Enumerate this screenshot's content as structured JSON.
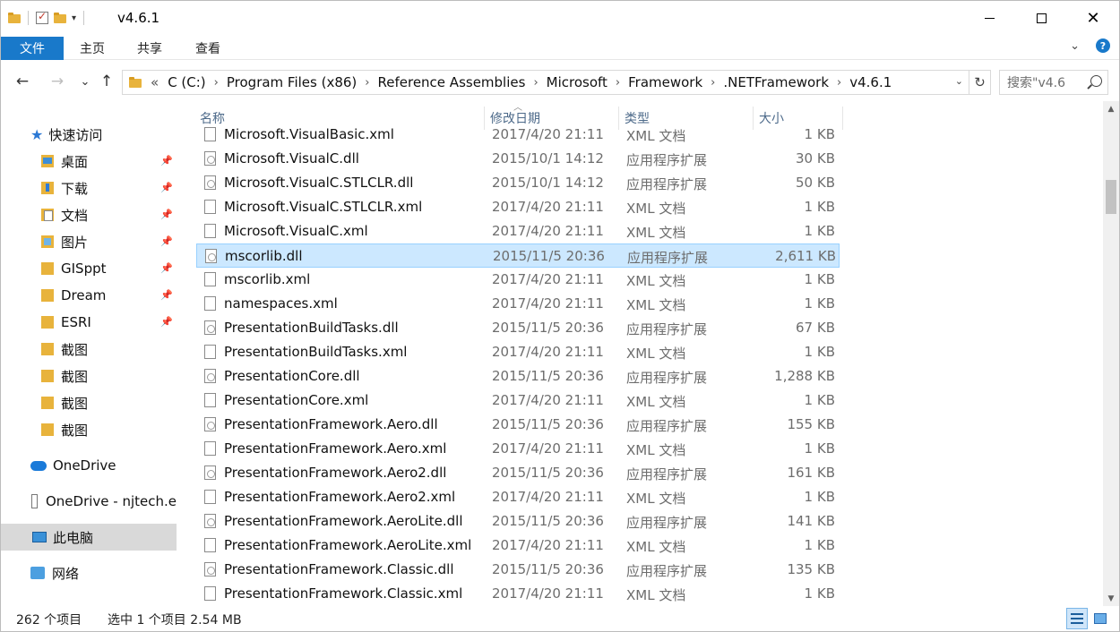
{
  "window": {
    "title": "v4.6.1",
    "controls": {
      "minimize": "minimize",
      "maximize": "maximize",
      "close": "✕"
    }
  },
  "ribbon": {
    "file_tab": "文件",
    "tabs": [
      "主页",
      "共享",
      "查看"
    ]
  },
  "navigation": {
    "back": "←",
    "forward": "→",
    "recent": "⌄",
    "up": "↑",
    "overflow": "«",
    "breadcrumbs": [
      "C (C:)",
      "Program Files (x86)",
      "Reference Assemblies",
      "Microsoft",
      "Framework",
      ".NETFramework",
      "v4.6.1"
    ],
    "separator": "›",
    "refresh": "↻",
    "search_placeholder": "搜索\"v4.6"
  },
  "sidebar": {
    "quick_access": "快速访问",
    "items": [
      {
        "label": "桌面",
        "icon": "desktop-folder-icon",
        "pinned": true
      },
      {
        "label": "下载",
        "icon": "download-folder-icon",
        "pinned": true
      },
      {
        "label": "文档",
        "icon": "documents-folder-icon",
        "pinned": true
      },
      {
        "label": "图片",
        "icon": "pictures-folder-icon",
        "pinned": true
      },
      {
        "label": "GISppt",
        "icon": "folder-icon",
        "pinned": true
      },
      {
        "label": "Dream",
        "icon": "folder-icon",
        "pinned": true
      },
      {
        "label": "ESRI",
        "icon": "folder-icon",
        "pinned": true
      },
      {
        "label": "截图",
        "icon": "folder-icon",
        "pinned": false
      },
      {
        "label": "截图",
        "icon": "folder-icon",
        "pinned": false
      },
      {
        "label": "截图",
        "icon": "folder-icon",
        "pinned": false
      },
      {
        "label": "截图",
        "icon": "folder-icon",
        "pinned": false
      }
    ],
    "onedrive": "OneDrive",
    "onedrive_org": "OneDrive - njtech.e",
    "this_pc": "此电脑",
    "network": "网络"
  },
  "columns": {
    "name": "名称",
    "date": "修改日期",
    "type": "类型",
    "size": "大小"
  },
  "files": [
    {
      "name": "Microsoft.VisualBasic.xml",
      "date": "2017/4/20 21:11",
      "type": "XML 文档",
      "size": "1 KB",
      "kind": "xml",
      "selected": false
    },
    {
      "name": "Microsoft.VisualC.dll",
      "date": "2015/10/1 14:12",
      "type": "应用程序扩展",
      "size": "30 KB",
      "kind": "dll",
      "selected": false
    },
    {
      "name": "Microsoft.VisualC.STLCLR.dll",
      "date": "2015/10/1 14:12",
      "type": "应用程序扩展",
      "size": "50 KB",
      "kind": "dll",
      "selected": false
    },
    {
      "name": "Microsoft.VisualC.STLCLR.xml",
      "date": "2017/4/20 21:11",
      "type": "XML 文档",
      "size": "1 KB",
      "kind": "xml",
      "selected": false
    },
    {
      "name": "Microsoft.VisualC.xml",
      "date": "2017/4/20 21:11",
      "type": "XML 文档",
      "size": "1 KB",
      "kind": "xml",
      "selected": false
    },
    {
      "name": "mscorlib.dll",
      "date": "2015/11/5 20:36",
      "type": "应用程序扩展",
      "size": "2,611 KB",
      "kind": "dll",
      "selected": true
    },
    {
      "name": "mscorlib.xml",
      "date": "2017/4/20 21:11",
      "type": "XML 文档",
      "size": "1 KB",
      "kind": "xml",
      "selected": false
    },
    {
      "name": "namespaces.xml",
      "date": "2017/4/20 21:11",
      "type": "XML 文档",
      "size": "1 KB",
      "kind": "xml",
      "selected": false
    },
    {
      "name": "PresentationBuildTasks.dll",
      "date": "2015/11/5 20:36",
      "type": "应用程序扩展",
      "size": "67 KB",
      "kind": "dll",
      "selected": false
    },
    {
      "name": "PresentationBuildTasks.xml",
      "date": "2017/4/20 21:11",
      "type": "XML 文档",
      "size": "1 KB",
      "kind": "xml",
      "selected": false
    },
    {
      "name": "PresentationCore.dll",
      "date": "2015/11/5 20:36",
      "type": "应用程序扩展",
      "size": "1,288 KB",
      "kind": "dll",
      "selected": false
    },
    {
      "name": "PresentationCore.xml",
      "date": "2017/4/20 21:11",
      "type": "XML 文档",
      "size": "1 KB",
      "kind": "xml",
      "selected": false
    },
    {
      "name": "PresentationFramework.Aero.dll",
      "date": "2015/11/5 20:36",
      "type": "应用程序扩展",
      "size": "155 KB",
      "kind": "dll",
      "selected": false
    },
    {
      "name": "PresentationFramework.Aero.xml",
      "date": "2017/4/20 21:11",
      "type": "XML 文档",
      "size": "1 KB",
      "kind": "xml",
      "selected": false
    },
    {
      "name": "PresentationFramework.Aero2.dll",
      "date": "2015/11/5 20:36",
      "type": "应用程序扩展",
      "size": "161 KB",
      "kind": "dll",
      "selected": false
    },
    {
      "name": "PresentationFramework.Aero2.xml",
      "date": "2017/4/20 21:11",
      "type": "XML 文档",
      "size": "1 KB",
      "kind": "xml",
      "selected": false
    },
    {
      "name": "PresentationFramework.AeroLite.dll",
      "date": "2015/11/5 20:36",
      "type": "应用程序扩展",
      "size": "141 KB",
      "kind": "dll",
      "selected": false
    },
    {
      "name": "PresentationFramework.AeroLite.xml",
      "date": "2017/4/20 21:11",
      "type": "XML 文档",
      "size": "1 KB",
      "kind": "xml",
      "selected": false
    },
    {
      "name": "PresentationFramework.Classic.dll",
      "date": "2015/11/5 20:36",
      "type": "应用程序扩展",
      "size": "135 KB",
      "kind": "dll",
      "selected": false
    },
    {
      "name": "PresentationFramework.Classic.xml",
      "date": "2017/4/20 21:11",
      "type": "XML 文档",
      "size": "1 KB",
      "kind": "xml",
      "selected": false
    }
  ],
  "status": {
    "item_count": "262 个项目",
    "selection": "选中 1 个项目  2.54 MB"
  },
  "colors": {
    "accent": "#1979ca",
    "selected_row": "#cce8ff",
    "selected_nav": "#d9d9d9",
    "folder": "#e8b33c"
  }
}
